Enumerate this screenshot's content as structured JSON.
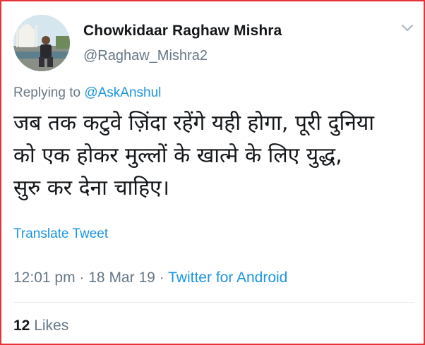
{
  "author": {
    "display_name": "Chowkidaar Raghaw Mishra",
    "handle": "@Raghaw_Mishra2"
  },
  "reply": {
    "prefix": "Replying to",
    "mention": "@AskAnshul"
  },
  "tweet": {
    "lines": [
      "जब तक कटुवे ज़िंदा रहेंगे यही होगा, पूरी दुनिया",
      "को एक होकर मुल्लों के खात्मे के लिए युद्ध,",
      "सुरु कर देना चाहिए।"
    ]
  },
  "translate_label": "Translate Tweet",
  "meta": {
    "time": "12:01 pm",
    "date": "18 Mar 19",
    "separator": "·",
    "source": "Twitter for Android"
  },
  "engagement": {
    "likes_count": "12",
    "likes_label": "Likes"
  },
  "colors": {
    "border": "#e8323a",
    "link": "#1b95e0",
    "secondary_text": "#657786",
    "primary_text": "#14171a"
  },
  "icons": [
    "avatar",
    "chevron-down-icon"
  ]
}
